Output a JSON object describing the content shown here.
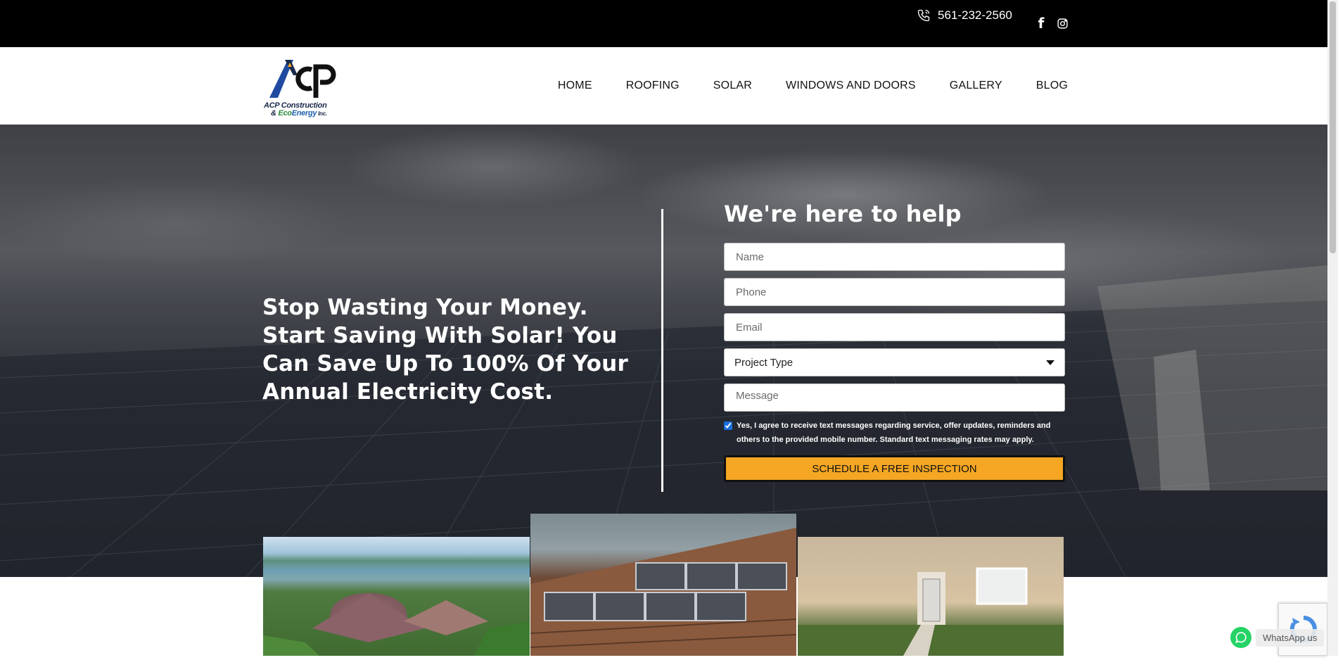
{
  "topbar": {
    "phone": "561-232-2560",
    "icons": [
      "phone-icon",
      "facebook-icon",
      "instagram-icon"
    ]
  },
  "header": {
    "logo_line1": "ACP Construction",
    "logo_amp": "& ",
    "logo_eco": "Eco",
    "logo_energy": "Energy",
    "logo_inc": " Inc.",
    "nav": [
      "HOME",
      "ROOFING",
      "SOLAR",
      "WINDOWS AND DOORS",
      "GALLERY",
      "BLOG"
    ]
  },
  "hero": {
    "headline": "Stop Wasting Your Money. Start Saving With Solar! You Can Save Up To 100% Of Your Annual Electricity Cost."
  },
  "form": {
    "title": "We're here to help",
    "name_placeholder": "Name",
    "phone_placeholder": "Phone",
    "email_placeholder": "Email",
    "project_type": "Project Type",
    "message_placeholder": "Message",
    "consent_checked": true,
    "consent_text": "Yes, I agree to receive text messages regarding service, offer updates, reminders and others to the provided mobile number. Standard text messaging rates may apply.",
    "submit_label": "SCHEDULE A FREE INSPECTION"
  },
  "whatsapp": {
    "label": "WhatsApp us"
  },
  "colors": {
    "accent": "#f5a623",
    "topbar": "#000000",
    "whatsapp": "#25d366"
  }
}
